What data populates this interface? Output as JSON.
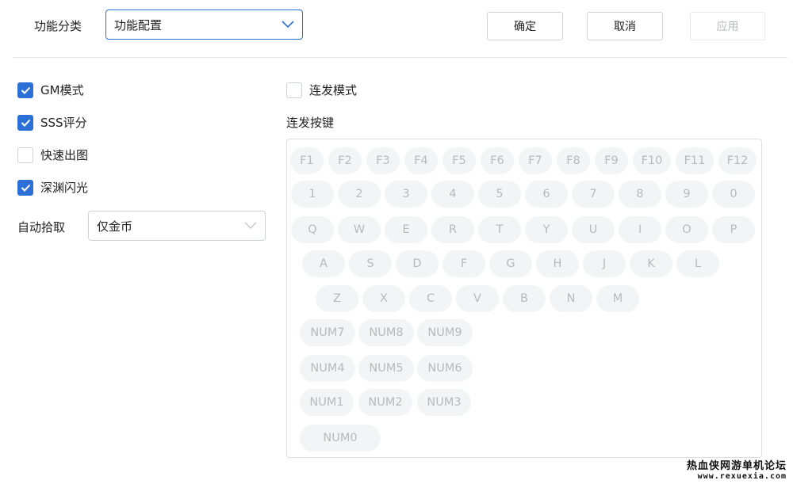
{
  "header": {
    "category_label": "功能分类",
    "category_value": "功能配置",
    "confirm": "确定",
    "cancel": "取消",
    "apply": "应用"
  },
  "left": {
    "checkboxes": [
      {
        "label": "GM模式",
        "checked": true
      },
      {
        "label": "SSS评分",
        "checked": true
      },
      {
        "label": "快速出图",
        "checked": false
      },
      {
        "label": "深渊闪光",
        "checked": true
      }
    ],
    "autopick_label": "自动拾取",
    "autopick_value": "仅金币"
  },
  "right": {
    "burst_mode_label": "连发模式",
    "burst_mode_checked": false,
    "burst_keys_label": "连发按键",
    "key_rows": [
      [
        "F1",
        "F2",
        "F3",
        "F4",
        "F5",
        "F6",
        "F7",
        "F8",
        "F9",
        "F10",
        "F11",
        "F12"
      ],
      [
        "1",
        "2",
        "3",
        "4",
        "5",
        "6",
        "7",
        "8",
        "9",
        "0"
      ],
      [
        "Q",
        "W",
        "E",
        "R",
        "T",
        "Y",
        "U",
        "I",
        "O",
        "P"
      ],
      [
        "A",
        "S",
        "D",
        "F",
        "G",
        "H",
        "J",
        "K",
        "L"
      ],
      [
        "Z",
        "X",
        "C",
        "V",
        "B",
        "N",
        "M"
      ],
      [
        "NUM7",
        "NUM8",
        "NUM9"
      ],
      [
        "NUM4",
        "NUM5",
        "NUM6"
      ],
      [
        "NUM1",
        "NUM2",
        "NUM3"
      ],
      [
        "NUM0"
      ]
    ]
  },
  "watermark": {
    "line1": "热血侠网游单机论坛",
    "line2": "www.rexuexia.com"
  },
  "colors": {
    "accent": "#2c6fd6",
    "key_bg": "#f3f4f5",
    "key_text": "#b6babf"
  }
}
